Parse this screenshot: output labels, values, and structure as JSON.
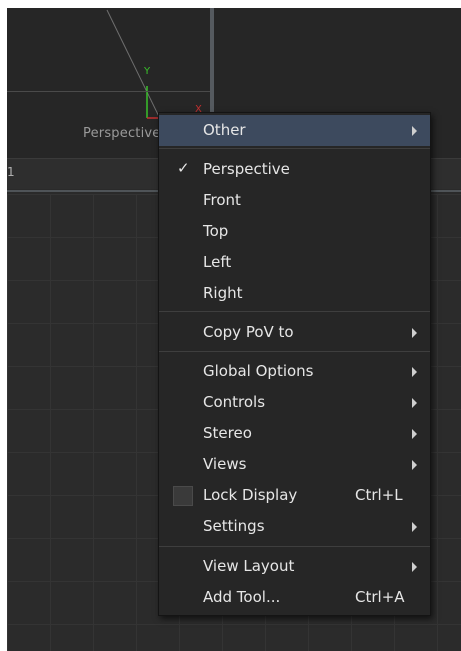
{
  "viewer": {
    "view_label": "Perspective",
    "strip_text": "1",
    "axis_y": "Y",
    "axis_x": "X"
  },
  "context_menu": {
    "items": [
      {
        "label": "Other",
        "submenu": true,
        "highlighted": true
      },
      {
        "label": "Perspective",
        "checked": true
      },
      {
        "label": "Front"
      },
      {
        "label": "Top"
      },
      {
        "label": "Left"
      },
      {
        "label": "Right"
      },
      {
        "label": "Copy PoV to",
        "submenu": true
      },
      {
        "label": "Global Options",
        "submenu": true
      },
      {
        "label": "Controls",
        "submenu": true
      },
      {
        "label": "Stereo",
        "submenu": true
      },
      {
        "label": "Views",
        "submenu": true
      },
      {
        "label": "Lock Display",
        "shortcut": "Ctrl+L",
        "checkbox": true,
        "checked": false
      },
      {
        "label": "Settings",
        "submenu": true
      },
      {
        "label": "View Layout",
        "submenu": true
      },
      {
        "label": "Add Tool...",
        "shortcut": "Ctrl+A"
      }
    ]
  },
  "colors": {
    "highlight": "#3d4a5e",
    "axis_y": "#39c12a",
    "axis_x": "#c23030"
  }
}
